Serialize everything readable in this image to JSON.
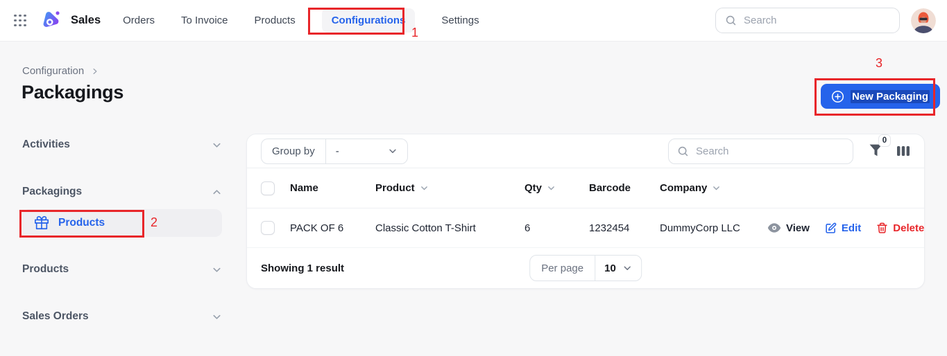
{
  "topbar": {
    "app_name": "Sales",
    "nav": [
      {
        "label": "Orders",
        "active": false
      },
      {
        "label": "To Invoice",
        "active": false
      },
      {
        "label": "Products",
        "active": false
      },
      {
        "label": "Configurations",
        "active": true
      },
      {
        "label": "Settings",
        "active": false
      }
    ],
    "search_placeholder": "Search"
  },
  "breadcrumb": {
    "label": "Configuration"
  },
  "page": {
    "title": "Packagings"
  },
  "header_actions": {
    "new_packaging": "New Packaging"
  },
  "annotations": {
    "n1": "1",
    "n2": "2",
    "n3": "3"
  },
  "sidebar": {
    "activities": "Activities",
    "packagings": "Packagings",
    "packagings_active_item": "Products",
    "products": "Products",
    "sales_orders": "Sales Orders"
  },
  "toolbar": {
    "group_by_label": "Group by",
    "group_by_value": "-",
    "search_placeholder": "Search",
    "filter_count": "0"
  },
  "table": {
    "headers": {
      "name": "Name",
      "product": "Product",
      "qty": "Qty",
      "barcode": "Barcode",
      "company": "Company"
    },
    "row": {
      "name": "PACK OF 6",
      "product": "Classic Cotton T-Shirt",
      "qty": "6",
      "barcode": "1232454",
      "company": "DummyCorp LLC"
    },
    "row_actions": {
      "view": "View",
      "edit": "Edit",
      "delete": "Delete"
    }
  },
  "footer": {
    "summary": "Showing 1 result",
    "per_page_label": "Per page",
    "per_page_value": "10"
  },
  "colors": {
    "accent_blue": "#2563eb",
    "annotation_red": "#e8262a",
    "delete_red": "#e8262a",
    "active_item_bg": "#efeff2",
    "page_bg": "#f7f7f8"
  }
}
